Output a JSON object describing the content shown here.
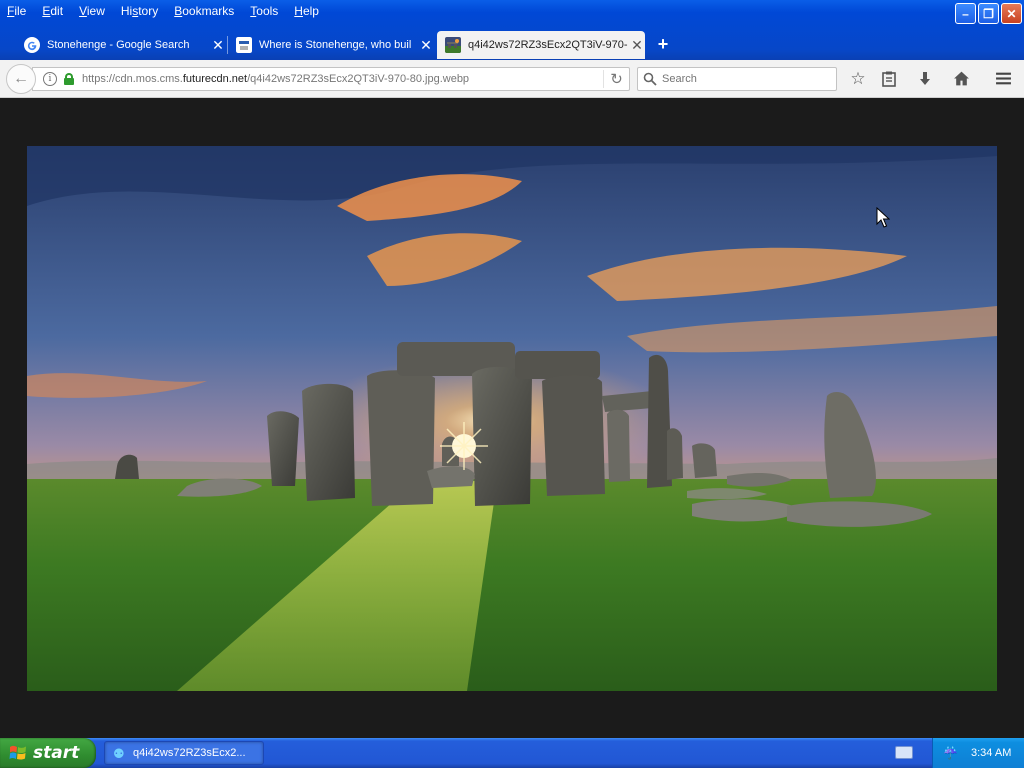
{
  "menu": [
    "File",
    "Edit",
    "View",
    "History",
    "Bookmarks",
    "Tools",
    "Help"
  ],
  "menu_accel": [
    "F",
    "E",
    "V",
    "s",
    "B",
    "T",
    "H"
  ],
  "tabs": [
    {
      "title": "Stonehenge - Google Search",
      "icon": "google-icon"
    },
    {
      "title": "Where is Stonehenge, who buil",
      "icon": "site-icon"
    },
    {
      "title": "q4i42ws72RZ3sEcx2QT3iV-970-",
      "icon": "image-thumbnail-icon"
    }
  ],
  "url": {
    "prefix": "https://cdn.mos.cms.",
    "domain": "futurecdn.net",
    "path": "/q4i42ws72RZ3sEcx2QT3iV-970-80.jpg.webp"
  },
  "search_placeholder": "Search",
  "taskbar": {
    "start": "start",
    "task": "q4i42ws72RZ3sEcx2...",
    "clock": "3:34 AM"
  },
  "colors": {
    "titlebar": "#0747c8",
    "taskbar": "#245edb",
    "start": "#2f8c2f",
    "tray": "#0f7fd4",
    "page_bg": "#1b1b1b"
  }
}
